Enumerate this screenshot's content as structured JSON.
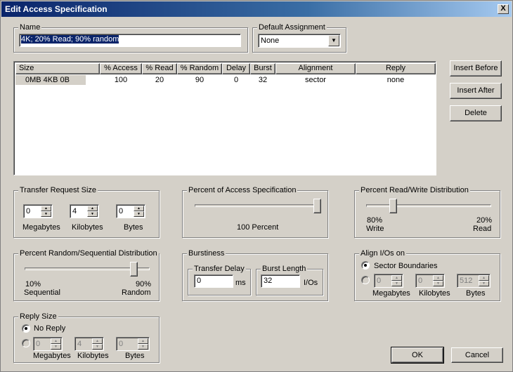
{
  "window": {
    "title": "Edit Access Specification",
    "close_label": "X"
  },
  "name_group": {
    "legend": "Name",
    "value": "4K; 20% Read; 90% random"
  },
  "default_assignment": {
    "legend": "Default Assignment",
    "selected": "None"
  },
  "table": {
    "columns": [
      "Size",
      "% Access",
      "% Read",
      "% Random",
      "Delay",
      "Burst",
      "Alignment",
      "Reply"
    ],
    "rows": [
      {
        "size": "0MB   4KB   0B",
        "access": "100",
        "read": "20",
        "random": "90",
        "delay": "0",
        "burst": "32",
        "alignment": "sector",
        "reply": "none"
      }
    ]
  },
  "buttons": {
    "insert_before": "Insert Before",
    "insert_after": "Insert After",
    "delete": "Delete",
    "ok": "OK",
    "cancel": "Cancel"
  },
  "transfer_request_size": {
    "legend": "Transfer Request Size",
    "megabytes": "0",
    "kilobytes": "4",
    "bytes": "0",
    "megabytes_label": "Megabytes",
    "kilobytes_label": "Kilobytes",
    "bytes_label": "Bytes"
  },
  "percent_access": {
    "legend": "Percent of Access Specification",
    "value_label": "100 Percent",
    "value": 100
  },
  "read_write": {
    "legend": "Percent Read/Write Distribution",
    "left_pct": "80%",
    "left_label": "Write",
    "right_pct": "20%",
    "right_label": "Read",
    "read_percent": 20
  },
  "random_sequential": {
    "legend": "Percent Random/Sequential Distribution",
    "left_pct": "10%",
    "left_label": "Sequential",
    "right_pct": "90%",
    "right_label": "Random",
    "random_percent": 90
  },
  "burstiness": {
    "legend": "Burstiness",
    "transfer_delay_legend": "Transfer Delay",
    "transfer_delay_value": "0",
    "transfer_delay_unit": "ms",
    "burst_length_legend": "Burst Length",
    "burst_length_value": "32",
    "burst_length_unit": "I/Os"
  },
  "align_ios": {
    "legend": "Align I/Os on",
    "sector_label": "Sector Boundaries",
    "megabytes": "0",
    "kilobytes": "0",
    "bytes": "512",
    "megabytes_label": "Megabytes",
    "kilobytes_label": "Kilobytes",
    "bytes_label": "Bytes"
  },
  "reply_size": {
    "legend": "Reply Size",
    "no_reply_label": "No Reply",
    "megabytes": "0",
    "kilobytes": "4",
    "bytes": "0",
    "megabytes_label": "Megabytes",
    "kilobytes_label": "Kilobytes",
    "bytes_label": "Bytes"
  }
}
